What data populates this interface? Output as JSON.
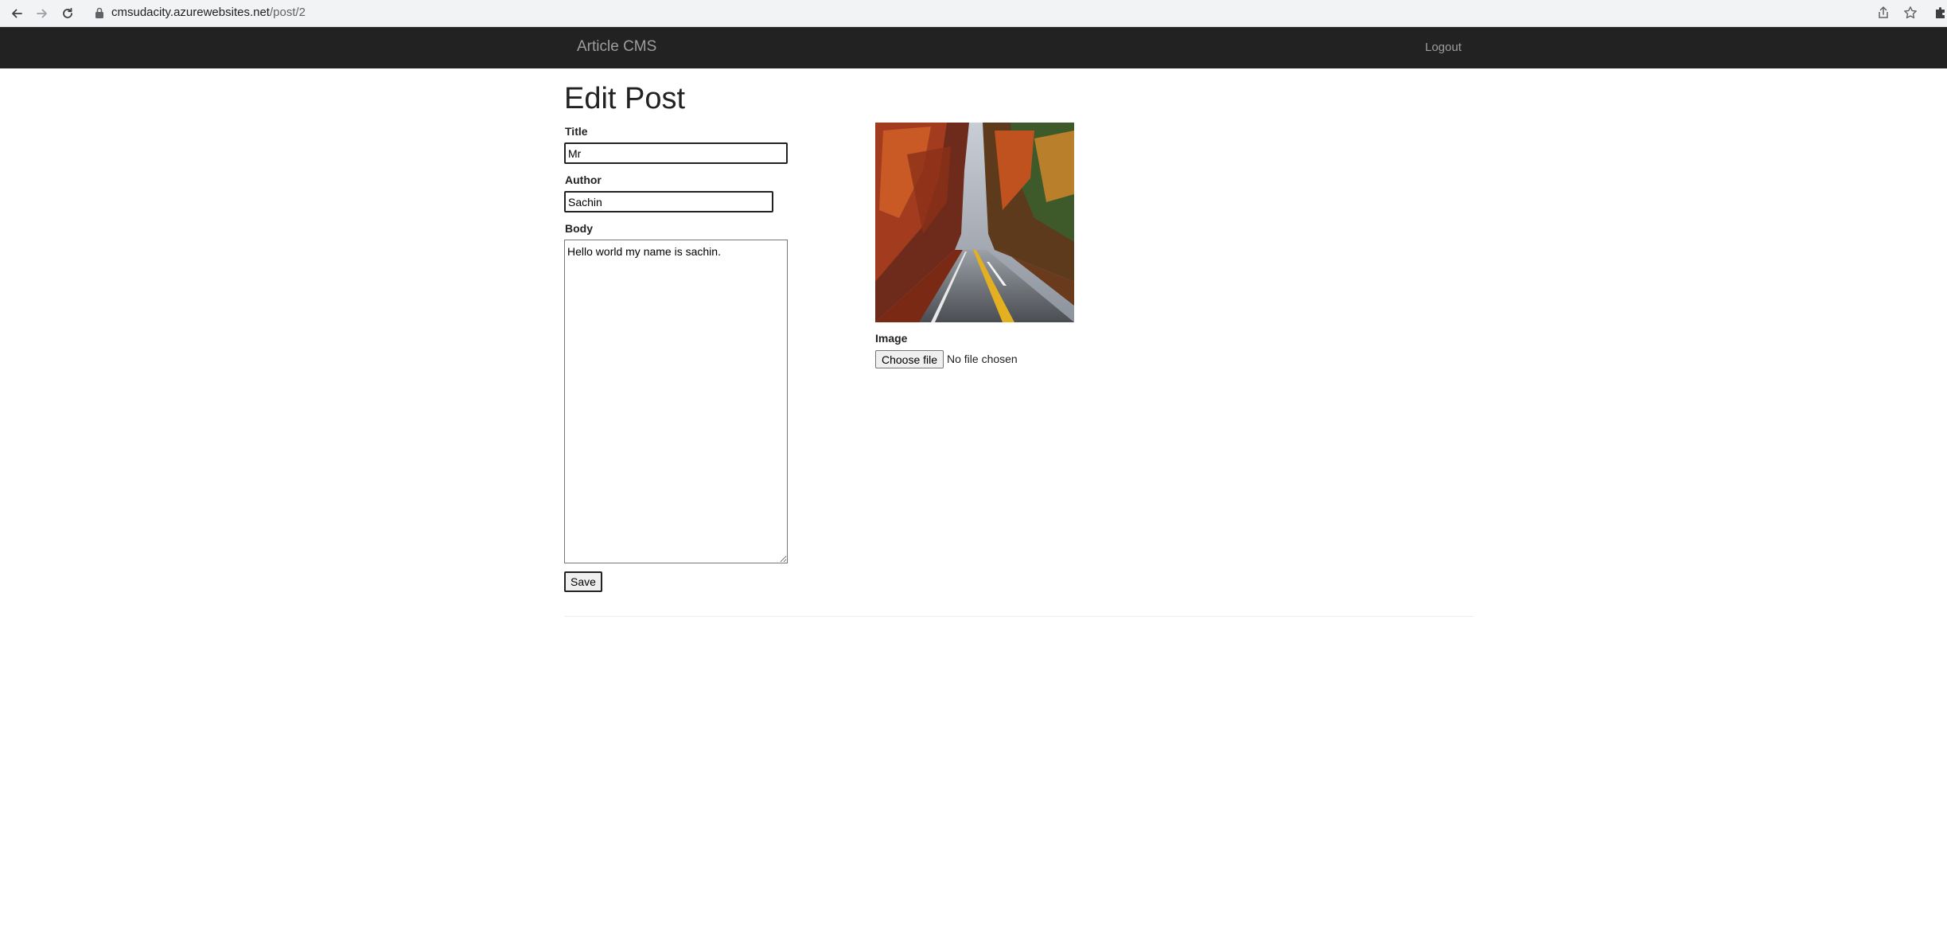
{
  "browser": {
    "url_host": "cmsudacity.azurewebsites.net",
    "url_path": "/post/2"
  },
  "navbar": {
    "brand": "Article CMS",
    "logout_label": "Logout"
  },
  "page": {
    "title": "Edit Post"
  },
  "form": {
    "title_label": "Title",
    "title_value": "Mr",
    "author_label": "Author",
    "author_value": "Sachin",
    "body_label": "Body",
    "body_value": "Hello world my name is sachin.",
    "save_label": "Save"
  },
  "image_panel": {
    "image_label": "Image",
    "choose_file_label": "Choose file",
    "no_file_text": "No file chosen"
  },
  "colors": {
    "navbar_bg": "#222222",
    "navbar_text": "#9d9d9d"
  }
}
